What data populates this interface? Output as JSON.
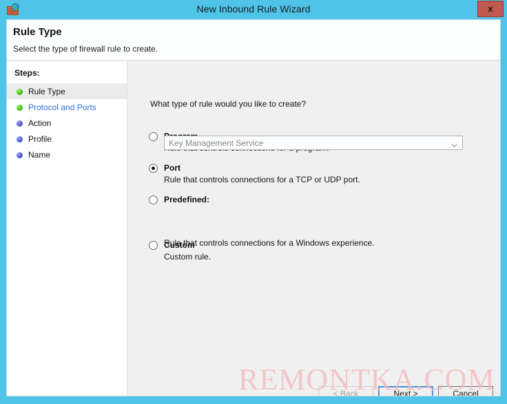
{
  "window": {
    "title": "New Inbound Rule Wizard",
    "icon": "firewall-globe-icon",
    "close_label": "x",
    "accent_color": "#4fc3e8",
    "close_color": "#c0594f"
  },
  "banner": {
    "title": "Rule Type",
    "subtitle": "Select the type of firewall rule to create."
  },
  "sidebar": {
    "heading": "Steps:",
    "items": [
      {
        "label": "Rule Type",
        "state": "done",
        "active": true,
        "link": false
      },
      {
        "label": "Protocol and Ports",
        "state": "done",
        "active": false,
        "link": true
      },
      {
        "label": "Action",
        "state": "todo",
        "active": false,
        "link": false
      },
      {
        "label": "Profile",
        "state": "todo",
        "active": false,
        "link": false
      },
      {
        "label": "Name",
        "state": "todo",
        "active": false,
        "link": false
      }
    ]
  },
  "main": {
    "question": "What type of rule would you like to create?",
    "options": [
      {
        "id": "program",
        "label": "Program",
        "description": "Rule that controls connections for a program.",
        "selected": false
      },
      {
        "id": "port",
        "label": "Port",
        "description": "Rule that controls connections for a TCP or UDP port.",
        "selected": true
      },
      {
        "id": "predefined",
        "label": "Predefined:",
        "description": "Rule that controls connections for a Windows experience.",
        "selected": false
      },
      {
        "id": "custom",
        "label": "Custom",
        "description": "Custom rule.",
        "selected": false
      }
    ],
    "predefined_combo": {
      "value": "Key Management Service",
      "enabled": false,
      "arrow_icon": "chevron-down-icon"
    }
  },
  "footer": {
    "back_label": "< Back",
    "next_label": "Next >",
    "cancel_label": "Cancel"
  },
  "watermark": {
    "text": "REMONTKA.COM"
  }
}
